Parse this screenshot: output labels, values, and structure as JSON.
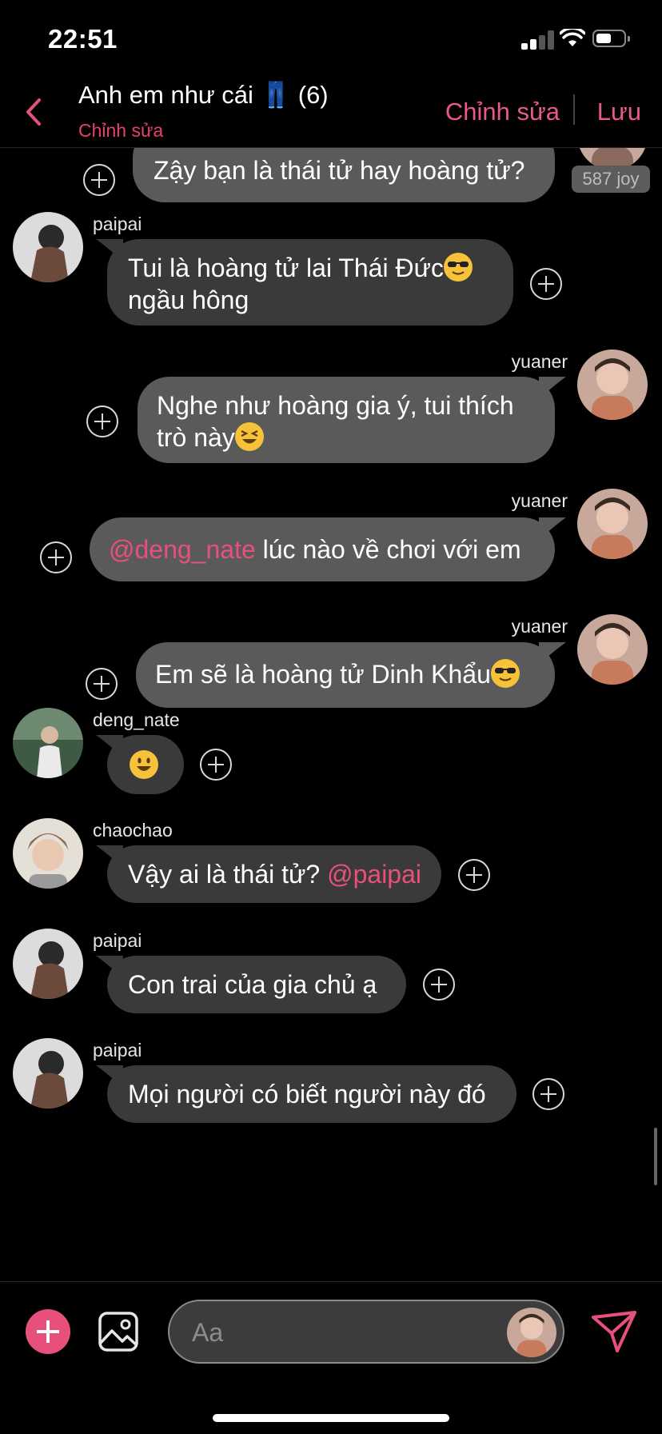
{
  "status_bar": {
    "time": "22:51"
  },
  "header": {
    "title": "Anh em như cái 👖 (6)",
    "subtitle": "Chỉnh sửa",
    "edit_label": "Chỉnh sửa",
    "save_label": "Lưu"
  },
  "colors": {
    "accent": "#e8507c",
    "bubble_incoming": "#3a3a3a",
    "bubble_outgoing": "#5a5a5a",
    "background": "#000000"
  },
  "messages": [
    {
      "direction": "out",
      "text": "Zậy bạn là thái tử hay hoàng tử?",
      "read_tag": "587 joy"
    },
    {
      "direction": "in",
      "sender": "paipai",
      "line1": "Tui là hoàng tử lai Thái Đức",
      "emoji": "😎",
      "line2": "ngầu hông"
    },
    {
      "direction": "out",
      "sender": "yuaner",
      "line1": "Nghe như hoàng gia ý, tui thích",
      "line2": "trò này",
      "emoji": "😆"
    },
    {
      "direction": "out",
      "sender": "yuaner",
      "mention": "@deng_nate",
      "text": " lúc nào về chơi với em"
    },
    {
      "direction": "out",
      "sender": "yuaner",
      "text": "Em sẽ là hoàng tử Dinh Khẩu",
      "emoji": "😎"
    },
    {
      "direction": "in",
      "sender": "deng_nate",
      "emoji": "😃"
    },
    {
      "direction": "in",
      "sender": "chaochao",
      "text": "Vậy ai là thái tử? ",
      "mention": "@paipai"
    },
    {
      "direction": "in",
      "sender": "paipai",
      "text": "Con trai của gia chủ ạ"
    },
    {
      "direction": "in",
      "sender": "paipai",
      "text": "Mọi người có biết người này đó"
    }
  ],
  "composer": {
    "placeholder": "Aa"
  }
}
